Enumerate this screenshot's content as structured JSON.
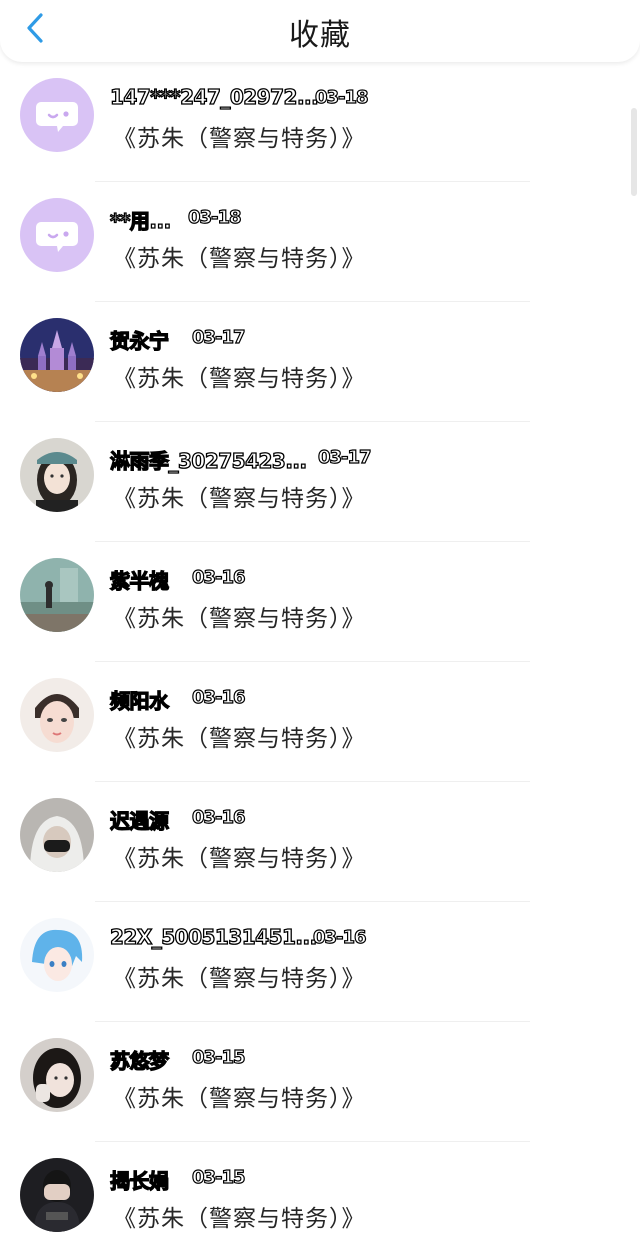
{
  "header": {
    "title": "收藏",
    "back_icon": "chevron-left-icon",
    "accent": "#2f9be6"
  },
  "items": [
    {
      "name": "147***247_02972...",
      "date": "03-18",
      "book": "《苏朱（警察与特务）》",
      "avatar": "chat-bubble-icon"
    },
    {
      "name": "**用...",
      "date": "03-18",
      "book": "《苏朱（警察与特务）》",
      "avatar": "chat-bubble-icon"
    },
    {
      "name": "贺永宁",
      "date": "03-17",
      "book": "《苏朱（警察与特务）》",
      "avatar": "castle-photo"
    },
    {
      "name": "淋雨季_30275423...",
      "date": "03-17",
      "book": "《苏朱（警察与特务）》",
      "avatar": "girl-photo"
    },
    {
      "name": "紫半槐",
      "date": "03-16",
      "book": "《苏朱（警察与特务）》",
      "avatar": "scene-photo"
    },
    {
      "name": "频阳水",
      "date": "03-16",
      "book": "《苏朱（警察与特务）》",
      "avatar": "face-photo"
    },
    {
      "name": "迟遇源",
      "date": "03-16",
      "book": "《苏朱（警察与特务）》",
      "avatar": "hood-photo"
    },
    {
      "name": "22X_5005131451...",
      "date": "03-16",
      "book": "《苏朱（警察与特务）》",
      "avatar": "anime-photo"
    },
    {
      "name": "苏悠梦",
      "date": "03-15",
      "book": "《苏朱（警察与特务）》",
      "avatar": "girl2-photo"
    },
    {
      "name": "揭长娟",
      "date": "03-15",
      "book": "《苏朱（警察与特务）》",
      "avatar": "hands-photo"
    }
  ]
}
